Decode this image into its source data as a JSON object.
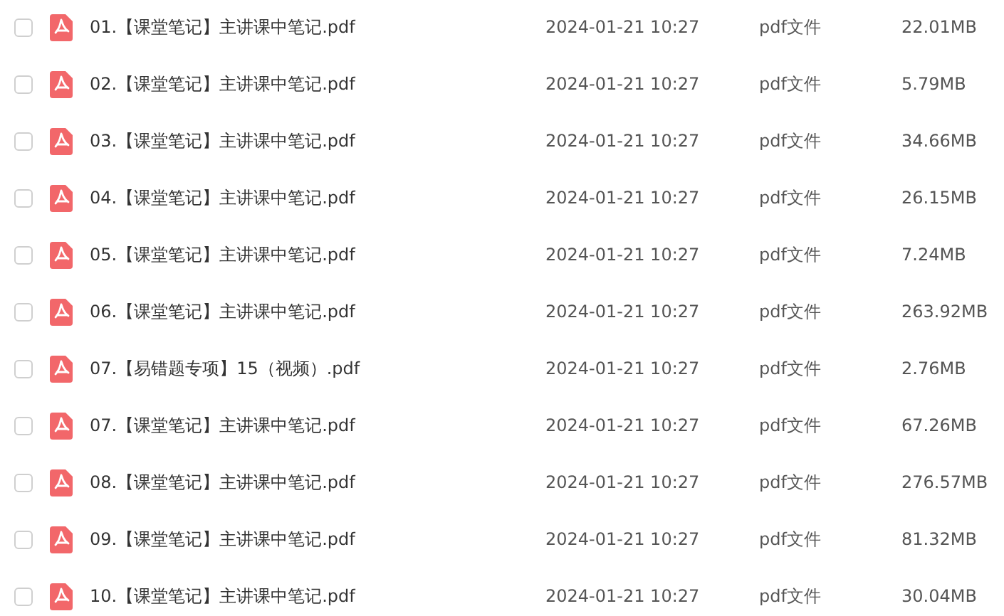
{
  "files": [
    {
      "name": "01.【课堂笔记】主讲课中笔记.pdf",
      "date": "2024-01-21 10:27",
      "type": "pdf文件",
      "size": "22.01MB",
      "checked": false
    },
    {
      "name": "02.【课堂笔记】主讲课中笔记.pdf",
      "date": "2024-01-21 10:27",
      "type": "pdf文件",
      "size": "5.79MB",
      "checked": false
    },
    {
      "name": "03.【课堂笔记】主讲课中笔记.pdf",
      "date": "2024-01-21 10:27",
      "type": "pdf文件",
      "size": "34.66MB",
      "checked": false
    },
    {
      "name": "04.【课堂笔记】主讲课中笔记.pdf",
      "date": "2024-01-21 10:27",
      "type": "pdf文件",
      "size": "26.15MB",
      "checked": false
    },
    {
      "name": "05.【课堂笔记】主讲课中笔记.pdf",
      "date": "2024-01-21 10:27",
      "type": "pdf文件",
      "size": "7.24MB",
      "checked": false
    },
    {
      "name": "06.【课堂笔记】主讲课中笔记.pdf",
      "date": "2024-01-21 10:27",
      "type": "pdf文件",
      "size": "263.92MB",
      "checked": false
    },
    {
      "name": "07.【易错题专项】15（视频）.pdf",
      "date": "2024-01-21 10:27",
      "type": "pdf文件",
      "size": "2.76MB",
      "checked": false
    },
    {
      "name": "07.【课堂笔记】主讲课中笔记.pdf",
      "date": "2024-01-21 10:27",
      "type": "pdf文件",
      "size": "67.26MB",
      "checked": false
    },
    {
      "name": "08.【课堂笔记】主讲课中笔记.pdf",
      "date": "2024-01-21 10:27",
      "type": "pdf文件",
      "size": "276.57MB",
      "checked": false
    },
    {
      "name": "09.【课堂笔记】主讲课中笔记.pdf",
      "date": "2024-01-21 10:27",
      "type": "pdf文件",
      "size": "81.32MB",
      "checked": false
    },
    {
      "name": "10.【课堂笔记】主讲课中笔记.pdf",
      "date": "2024-01-21 10:27",
      "type": "pdf文件",
      "size": "30.04MB",
      "checked": false
    }
  ]
}
